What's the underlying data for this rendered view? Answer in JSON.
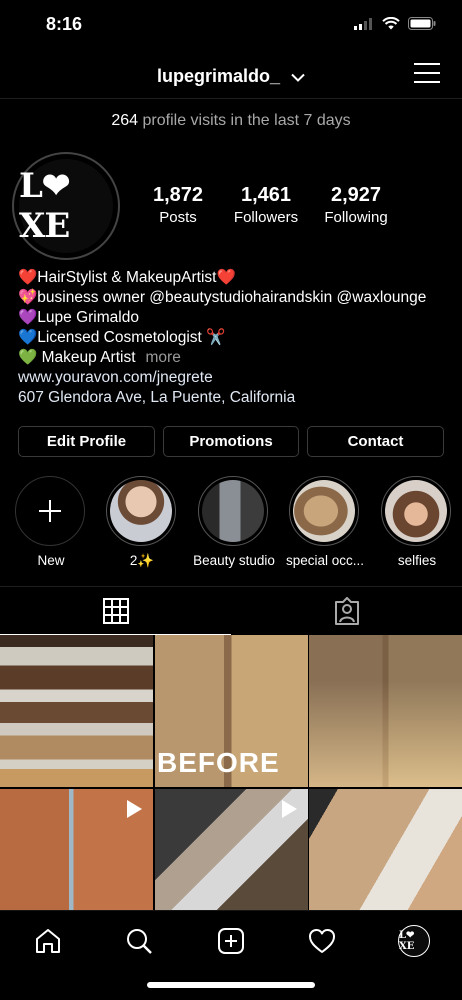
{
  "status": {
    "time": "8:16"
  },
  "header": {
    "username": "lupegrimaldo_",
    "chevron_icon": "chevron-down-icon",
    "menu_icon": "hamburger-menu-icon"
  },
  "insights": {
    "count": "264",
    "text": " profile visits in the last 7 days"
  },
  "profile": {
    "avatar_text": "L❤︎XE",
    "stats": [
      {
        "value": "1,872",
        "label": "Posts"
      },
      {
        "value": "1,461",
        "label": "Followers"
      },
      {
        "value": "2,927",
        "label": "Following"
      }
    ]
  },
  "bio": {
    "lines": [
      "❤️HairStylist & MakeupArtist❤️",
      "💖business owner @beautystudiohairandskin @waxlounge",
      "💜Lupe Grimaldo",
      "💙Licensed Cosmetologist ✂️",
      "💚 Makeup Artist"
    ],
    "more": "more",
    "website": "www.youravon.com/jnegrete",
    "address": "607 Glendora Ave, La Puente, California"
  },
  "actions": {
    "edit_profile": "Edit Profile",
    "promotions": "Promotions",
    "contact": "Contact"
  },
  "highlights": [
    {
      "label": "New",
      "icon": "plus-icon"
    },
    {
      "label": "2✨"
    },
    {
      "label": "Beauty studio"
    },
    {
      "label": "special occ..."
    },
    {
      "label": "selfies"
    }
  ],
  "tabs": [
    {
      "name": "grid",
      "icon": "grid-icon",
      "active": true
    },
    {
      "name": "tagged",
      "icon": "tagged-person-icon",
      "active": false
    }
  ],
  "posts": [
    {
      "caption": "",
      "video": false
    },
    {
      "caption": "BEFORE",
      "video": false
    },
    {
      "caption": "",
      "video": false
    },
    {
      "caption": "",
      "video": true
    },
    {
      "caption": "",
      "video": true
    },
    {
      "caption": "",
      "video": false
    }
  ],
  "nav": [
    {
      "name": "home",
      "icon": "home-icon"
    },
    {
      "name": "search",
      "icon": "search-icon"
    },
    {
      "name": "new-post",
      "icon": "add-post-icon"
    },
    {
      "name": "activity",
      "icon": "heart-icon"
    },
    {
      "name": "profile",
      "icon": "profile-avatar-icon"
    }
  ],
  "colors": {
    "background": "#000000",
    "muted_text": "#a8a8a8",
    "button_border": "#3a3a3a"
  }
}
